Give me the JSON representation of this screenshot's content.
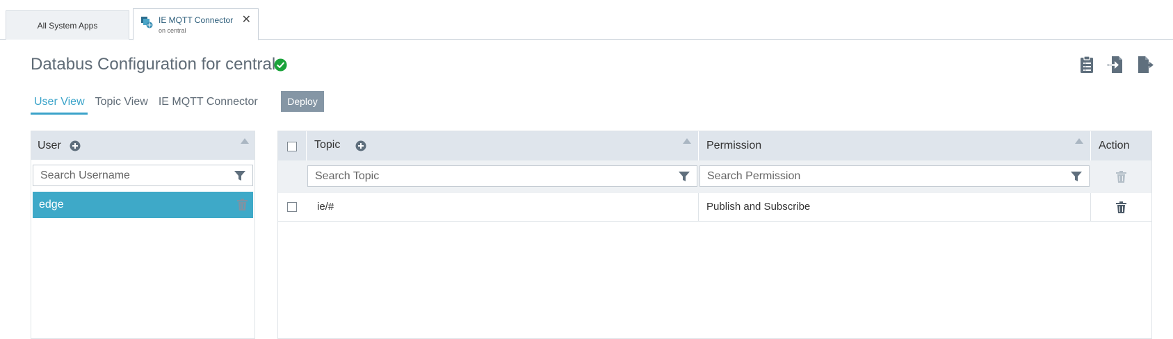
{
  "tabs": {
    "apps_label": "All System Apps",
    "mqtt_title": "IE MQTT Connector",
    "mqtt_subtitle": "on central",
    "close_glyph": "✕"
  },
  "header": {
    "title": "Databus Configuration for central",
    "status_icon": "check-circle-icon",
    "status_color": "#1aa33a",
    "actions": [
      "clipboard-icon",
      "import-icon",
      "export-icon"
    ]
  },
  "subtabs": {
    "items": [
      "User View",
      "Topic View",
      "IE MQTT Connector"
    ],
    "active": "User View",
    "deploy_label": "Deploy"
  },
  "user_panel": {
    "header": "User",
    "search_placeholder": "Search Username",
    "users": [
      "edge"
    ],
    "selected_color": "#3ea9c8"
  },
  "topic_table": {
    "columns": [
      "Topic",
      "Permission",
      "Action"
    ],
    "topic_placeholder": "Search Topic",
    "permission_placeholder": "Search Permission",
    "rows": [
      {
        "topic": "ie/#",
        "permission": "Publish and Subscribe"
      }
    ]
  }
}
